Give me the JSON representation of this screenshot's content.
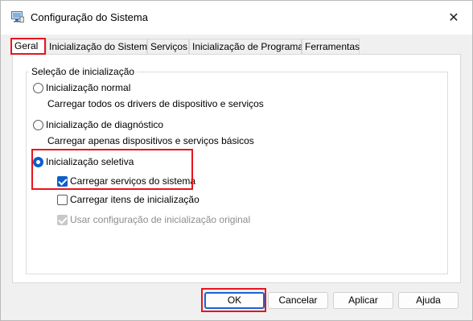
{
  "window": {
    "title": "Configuração do Sistema",
    "close_glyph": "✕",
    "accent_color": "#0b5fcc",
    "highlight_color": "#e8141e"
  },
  "tabs": [
    {
      "label": "Geral",
      "active": true
    },
    {
      "label": "Inicialização do Sistema",
      "active": false
    },
    {
      "label": "Serviços",
      "active": false
    },
    {
      "label": "Inicialização de Programas",
      "active": false
    },
    {
      "label": "Ferramentas",
      "active": false
    }
  ],
  "startup_group": {
    "label": "Seleção de inicialização",
    "normal": {
      "label": "Inicialização normal",
      "description": "Carregar todos os drivers de dispositivo e serviços",
      "selected": false
    },
    "diagnostic": {
      "label": "Inicialização de diagnóstico",
      "description": "Carregar apenas dispositivos e serviços básicos",
      "selected": false
    },
    "selective": {
      "label": "Inicialização seletiva",
      "selected": true
    },
    "load_system_services": {
      "label": "Carregar serviços do sistema",
      "checked": true
    },
    "load_startup_items": {
      "label": "Carregar itens de inicialização",
      "checked": false
    },
    "use_original_boot": {
      "label": "Usar configuração de inicialização original",
      "checked": true,
      "disabled": true
    }
  },
  "buttons": {
    "ok": "OK",
    "cancel": "Cancelar",
    "apply": "Aplicar",
    "help": "Ajuda"
  }
}
